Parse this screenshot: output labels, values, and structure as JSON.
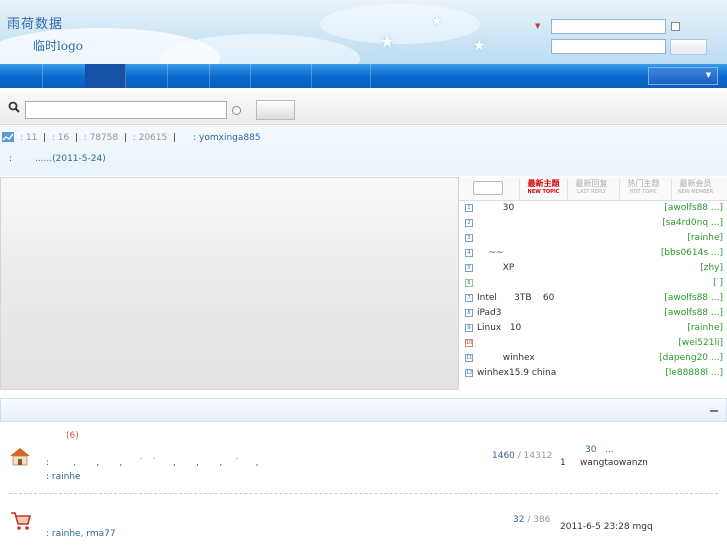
{
  "header": {
    "site_title": "雨荷数据",
    "logo_subtitle": "临时logo",
    "login": {
      "username_placeholder": "",
      "password_placeholder": ""
    }
  },
  "search": {
    "placeholder": ""
  },
  "stats": {
    "line": ": 11  |  : 16  |  : 78758  |  : 20615  |      : yomxinga885",
    "parts": [
      ": 11",
      ": 16",
      ": 78758",
      ": 20615"
    ],
    "newest_user": ": yomxinga885",
    "notice_prefix": ":",
    "notice": "......(2011-5-24)"
  },
  "hot_panel": {
    "tabs": [
      {
        "label": "最新主题",
        "sub": "NEW TOPIC",
        "active": true
      },
      {
        "label": "最新回复",
        "sub": "LAST REPLY",
        "active": false
      },
      {
        "label": "热门主题",
        "sub": "HOT TOPIC",
        "active": false
      },
      {
        "label": "最新会员",
        "sub": "NEW MEMBER",
        "active": false
      }
    ],
    "topics": [
      {
        "num": "1",
        "title": "         30",
        "author": "[awolfs88 ...]"
      },
      {
        "num": "2",
        "title": "",
        "author": "[sa4rd0nq ...]"
      },
      {
        "num": "3",
        "title": "",
        "author": "[rainhe]"
      },
      {
        "num": "4",
        "title": "    ~~",
        "author": "[bbs0614s ...]"
      },
      {
        "num": "5",
        "title": "         XP",
        "author": "[zhy]"
      },
      {
        "num": "6",
        "title": "",
        "author": "[ ]"
      },
      {
        "num": "7",
        "title": "Intel      3TB    60",
        "author": "[awolfs88 ...]"
      },
      {
        "num": "8",
        "title": "iPad3",
        "author": "[awolfs88 ...]"
      },
      {
        "num": "9",
        "title": "Linux   10",
        "author": "[rainhe]"
      },
      {
        "num": "10",
        "title": "",
        "author": "[wei521li]"
      },
      {
        "num": "11",
        "title": "         winhex",
        "author": "[dapeng20 ...]"
      },
      {
        "num": "12",
        "title": "winhex15.9 china",
        "author": "[le88888l ...]"
      }
    ]
  },
  "forums": [
    {
      "today": "(6)",
      "desc": ":      ,     ,     ,    ˙  ˙    ,     ,     ,   ˙    ,",
      "moderator": ": rainhe",
      "threads": "1460",
      "posts": "/ 14312",
      "last_title": "30   ...",
      "last_by": "1     wangtaowanzn"
    },
    {
      "today": "",
      "desc": "",
      "moderator": ": rainhe, rma77",
      "threads": "32",
      "posts": "/ 386",
      "last_title": "",
      "last_by": "2011-6-5 23:28 mgq"
    }
  ]
}
